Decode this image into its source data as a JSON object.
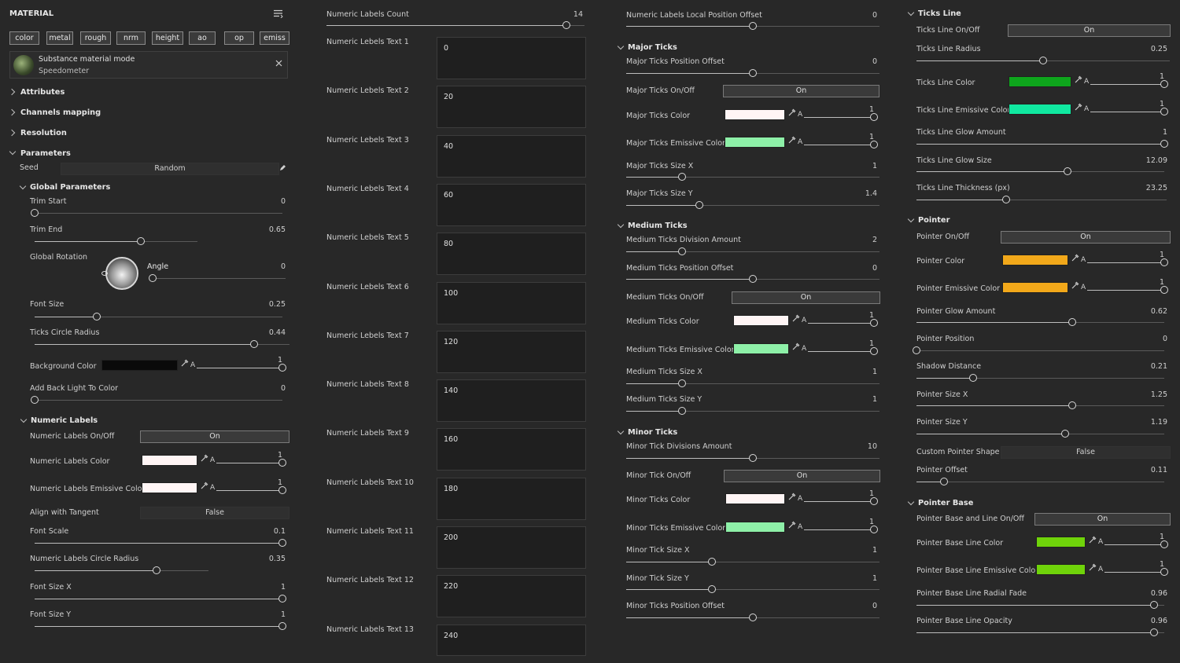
{
  "material": {
    "title": "MATERIAL",
    "chips": [
      "color",
      "metal",
      "rough",
      "nrm",
      "height",
      "ao",
      "op",
      "emiss"
    ],
    "substance": {
      "title": "Substance material mode",
      "subtitle": "Speedometer"
    },
    "sections": {
      "attributes": "Attributes",
      "channels": "Channels mapping",
      "resolution": "Resolution",
      "parameters": "Parameters"
    },
    "seed": {
      "label": "Seed",
      "value": "Random"
    },
    "global_params": "Global Parameters",
    "trim_start": {
      "label": "Trim Start",
      "value": "0",
      "frac": 0
    },
    "trim_end": {
      "label": "Trim End",
      "value": "0.65",
      "frac": 0.65
    },
    "global_rotation": "Global Rotation",
    "angle": {
      "label": "Angle",
      "value": "0",
      "frac": 0
    },
    "font_size": {
      "label": "Font Size",
      "value": "0.25",
      "frac": 0.25
    },
    "ticks_circle_radius": {
      "label": "Ticks Circle Radius",
      "value": "0.44",
      "frac": 0.86
    },
    "background_color": {
      "label": "Background Color",
      "color": "#0a0a0a",
      "alpha": "1"
    },
    "add_back_light": {
      "label": "Add Back Light To Color",
      "value": "0",
      "frac": 0
    },
    "numeric_labels_sec": "Numeric Labels",
    "nl_onoff": {
      "label": "Numeric Labels On/Off",
      "value": "On"
    },
    "nl_color": {
      "label": "Numeric Labels Color",
      "color": "#fff5f5",
      "alpha": "1"
    },
    "nl_emissive": {
      "label": "Numeric Labels Emissive Color",
      "color": "#fff5f5",
      "alpha": "1"
    },
    "align_tangent": {
      "label": "Align with Tangent",
      "value": "False"
    },
    "font_scale": {
      "label": "Font Scale",
      "value": "0.1",
      "frac": 1
    },
    "nl_circle_radius": {
      "label": "Numeric Labels Circle Radius",
      "value": "0.35",
      "frac": 0.7
    },
    "font_size_x": {
      "label": "Font Size X",
      "value": "1",
      "frac": 1
    },
    "font_size_y": {
      "label": "Font Size Y",
      "value": "1",
      "frac": 1
    },
    "alpha_letter": "A"
  },
  "labels_col": {
    "count": {
      "label": "Numeric Labels Count",
      "value": "14",
      "frac": 0.93
    },
    "texts": [
      {
        "label": "Numeric Lebels Text 1",
        "value": "0"
      },
      {
        "label": "Numeric Lebels Text 2",
        "value": "20"
      },
      {
        "label": "Numeric Lebels Text 3",
        "value": "40"
      },
      {
        "label": "Numeric Lebels Text 4",
        "value": "60"
      },
      {
        "label": "Numeric Lebels Text 5",
        "value": "80"
      },
      {
        "label": "Numeric Lebels Text 6",
        "value": "100"
      },
      {
        "label": "Numeric Lebels Text 7",
        "value": "120"
      },
      {
        "label": "Numeric Labels Text 8",
        "value": "140"
      },
      {
        "label": "Numeric Labels Text 9",
        "value": "160"
      },
      {
        "label": "Numeric Labels Text 10",
        "value": "180"
      },
      {
        "label": "Numeric Labels Text 11",
        "value": "200"
      },
      {
        "label": "Numeric Labels Text 12",
        "value": "220"
      },
      {
        "label": "Numeric Labels Text 13",
        "value": "240"
      }
    ]
  },
  "ticks_col": {
    "local_offset": {
      "label": "Numeric Labels Local Position Offset",
      "value": "0",
      "frac": 0.5
    },
    "major_sec": "Major Ticks",
    "major_pos_offset": {
      "label": "Major Ticks Position Offset",
      "value": "0",
      "frac": 0.5
    },
    "major_onoff": {
      "label": "Major Ticks On/Off",
      "value": "On"
    },
    "major_color": {
      "label": "Major Ticks Color",
      "color": "#fff5f5",
      "alpha": "1"
    },
    "major_emissive": {
      "label": "Major Ticks Emissive Color",
      "color": "#8ef0a8",
      "alpha": "1"
    },
    "major_size_x": {
      "label": "Major Ticks Size X",
      "value": "1",
      "frac": 0.22
    },
    "major_size_y": {
      "label": "Major Ticks Size Y",
      "value": "1.4",
      "frac": 0.29
    },
    "medium_sec": "Medium Ticks",
    "medium_div": {
      "label": "Medium Ticks Division Amount",
      "value": "2",
      "frac": 0.22
    },
    "medium_pos_offset": {
      "label": "Medium Ticks Position Offset",
      "value": "0",
      "frac": 0.5
    },
    "medium_onoff": {
      "label": "Medium Ticks On/Off",
      "value": "On"
    },
    "medium_color": {
      "label": "Medium Ticks Color",
      "color": "#fff5f5",
      "alpha": "1"
    },
    "medium_emissive": {
      "label": "Medium Ticks Emissive Color",
      "color": "#8ef0a8",
      "alpha": "1"
    },
    "medium_size_x": {
      "label": "Medium Ticks Size X",
      "value": "1",
      "frac": 0.22
    },
    "medium_size_y": {
      "label": "Medium Ticks Size Y",
      "value": "1",
      "frac": 0.22
    },
    "minor_sec": "Minor Ticks",
    "minor_div": {
      "label": "Minor Tick Divisions Amount",
      "value": "10",
      "frac": 0.5
    },
    "minor_onoff": {
      "label": "Minor Tick On/Off",
      "value": "On"
    },
    "minor_color": {
      "label": "Minor Ticks Color",
      "color": "#fff5f5",
      "alpha": "1"
    },
    "minor_emissive": {
      "label": "Minor Ticks Emissive Color",
      "color": "#8ef0a8",
      "alpha": "1"
    },
    "minor_size_x": {
      "label": "Minor Tick Size X",
      "value": "1",
      "frac": 0.34
    },
    "minor_size_y": {
      "label": "Minor Tick Size Y",
      "value": "1",
      "frac": 0.34
    },
    "minor_pos_offset": {
      "label": "Minor Ticks Position Offset",
      "value": "0",
      "frac": 0.5
    }
  },
  "pointer_col": {
    "ticks_line_sec": "Ticks Line",
    "tl_onoff": {
      "label": "Ticks Line On/Off",
      "value": "On"
    },
    "tl_radius": {
      "label": "Ticks Line Radius",
      "value": "0.25",
      "frac": 0.5
    },
    "tl_color": {
      "label": "Ticks Line Color",
      "color": "#0ea51c",
      "alpha": "1"
    },
    "tl_emissive": {
      "label": "Ticks Line Emissive Color",
      "color": "#10e8a0",
      "alpha": "1"
    },
    "tl_glow_amount": {
      "label": "Ticks Line Glow Amount",
      "value": "1",
      "frac": 1
    },
    "tl_glow_size": {
      "label": "Ticks Line Glow Size",
      "value": "12.09",
      "frac": 0.61
    },
    "tl_thickness": {
      "label": "Ticks Line Thickness (px)",
      "value": "23.25",
      "frac": 0.36
    },
    "pointer_sec": "Pointer",
    "p_onoff": {
      "label": "Pointer On/Off",
      "value": "On"
    },
    "p_color": {
      "label": "Pointer Color",
      "color": "#f2a81a",
      "alpha": "1"
    },
    "p_emissive": {
      "label": "Pointer Emissive Color",
      "color": "#f2a81a",
      "alpha": "1"
    },
    "p_glow": {
      "label": "Pointer Glow Amount",
      "value": "0.62",
      "frac": 0.63
    },
    "p_position": {
      "label": "Pointer Position",
      "value": "0",
      "frac": 0
    },
    "shadow_distance": {
      "label": "Shadow Distance",
      "value": "0.21",
      "frac": 0.23
    },
    "p_size_x": {
      "label": "Pointer Size X",
      "value": "1.25",
      "frac": 0.63
    },
    "p_size_y": {
      "label": "Pointer Size Y",
      "value": "1.19",
      "frac": 0.6
    },
    "custom_shape": {
      "label": "Custom Pointer Shape",
      "value": "False"
    },
    "p_offset": {
      "label": "Pointer Offset",
      "value": "0.11",
      "frac": 0.11
    },
    "pointer_base_sec": "Pointer Base",
    "pb_onoff": {
      "label": "Pointer Base and Line On/Off",
      "value": "On"
    },
    "pb_color": {
      "label": "Pointer Base Line Color",
      "color": "#6fd30a",
      "alpha": "1"
    },
    "pb_emissive": {
      "label": "Pointer Base Line Emissive Color",
      "color": "#6fd30a",
      "alpha": "1"
    },
    "pb_radial_fade": {
      "label": "Pointer Base Line Radial Fade",
      "value": "0.96",
      "frac": 0.96
    },
    "pb_opacity": {
      "label": "Pointer Base Line Opacity",
      "value": "0.96",
      "frac": 0.96
    }
  }
}
